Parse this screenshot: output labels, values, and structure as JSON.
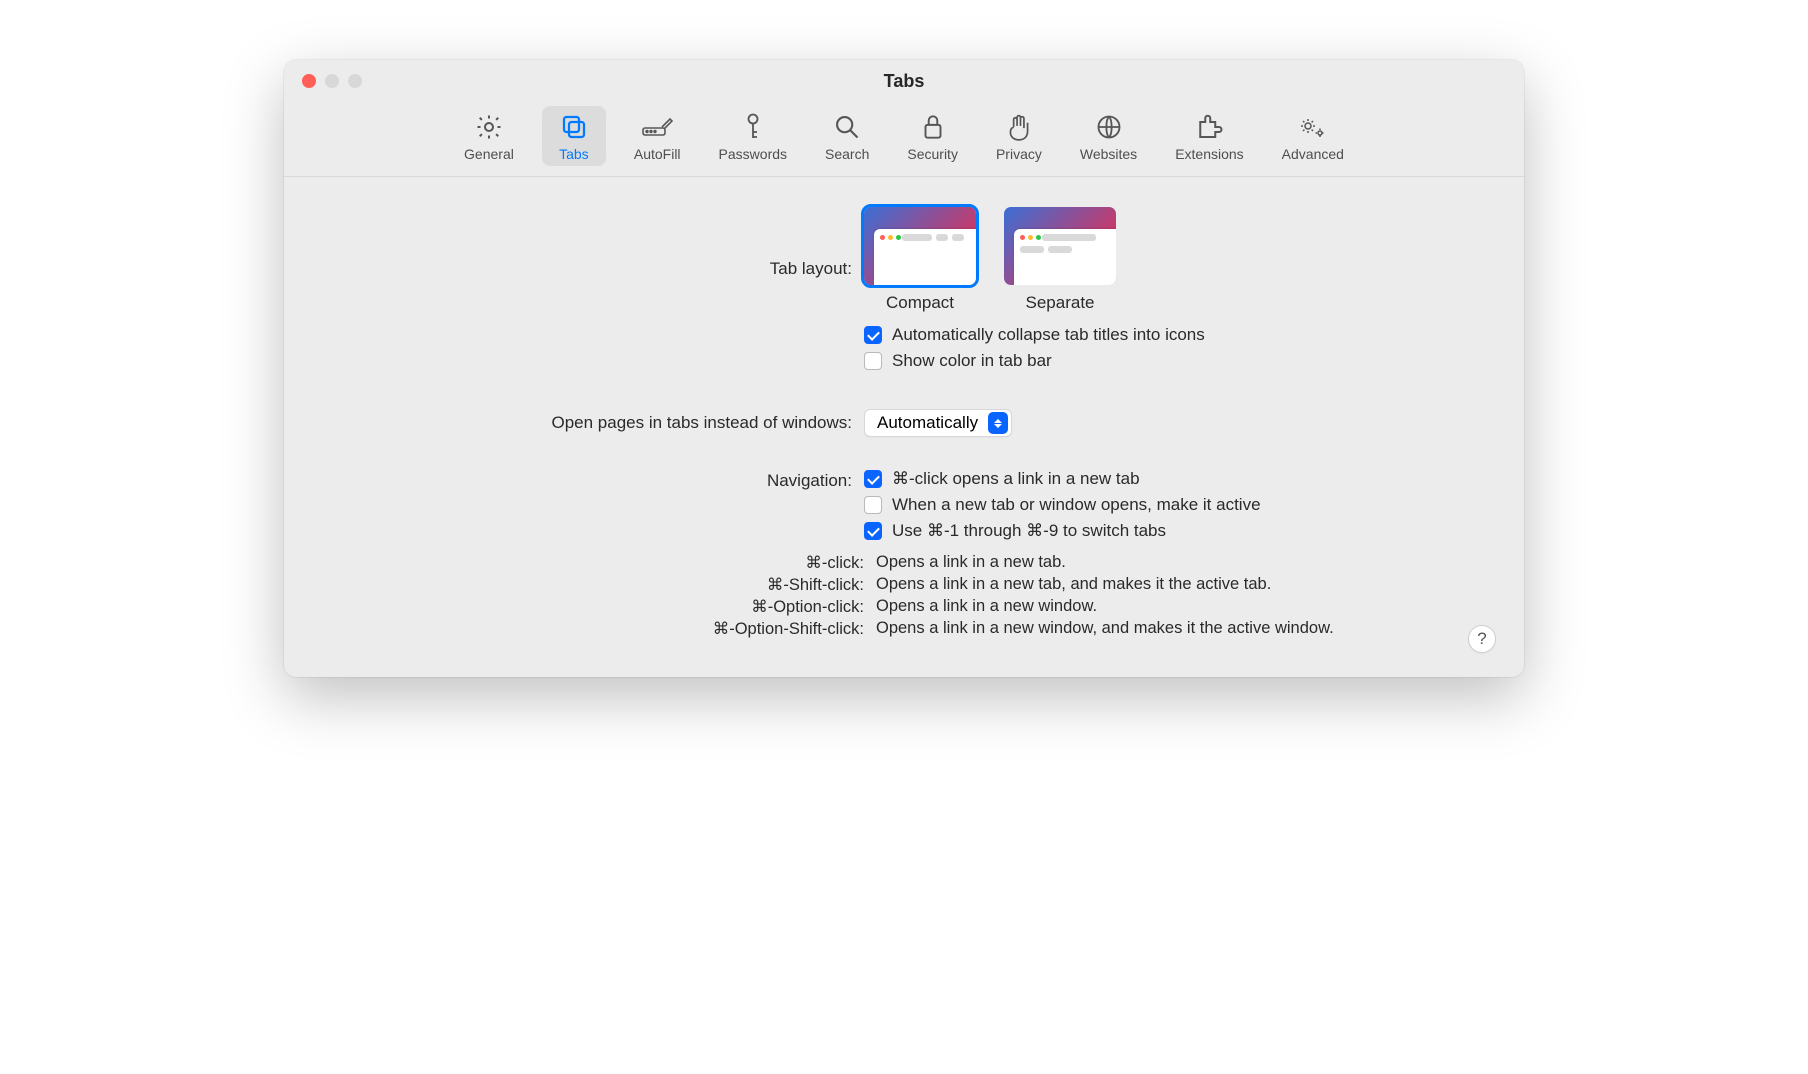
{
  "window": {
    "title": "Tabs"
  },
  "toolbar": {
    "items": [
      {
        "id": "general",
        "label": "General"
      },
      {
        "id": "tabs",
        "label": "Tabs"
      },
      {
        "id": "autofill",
        "label": "AutoFill"
      },
      {
        "id": "passwords",
        "label": "Passwords"
      },
      {
        "id": "search",
        "label": "Search"
      },
      {
        "id": "security",
        "label": "Security"
      },
      {
        "id": "privacy",
        "label": "Privacy"
      },
      {
        "id": "websites",
        "label": "Websites"
      },
      {
        "id": "extensions",
        "label": "Extensions"
      },
      {
        "id": "advanced",
        "label": "Advanced"
      }
    ],
    "selected": "tabs"
  },
  "tabLayout": {
    "label": "Tab layout:",
    "options": {
      "compact": "Compact",
      "separate": "Separate"
    },
    "selected": "compact",
    "collapseTitles": {
      "label": "Automatically collapse tab titles into icons",
      "checked": true
    },
    "showColor": {
      "label": "Show color in tab bar",
      "checked": false
    }
  },
  "openPages": {
    "label": "Open pages in tabs instead of windows:",
    "value": "Automatically"
  },
  "navigation": {
    "label": "Navigation:",
    "cmdClick": {
      "label": "⌘-click opens a link in a new tab",
      "checked": true
    },
    "makeActive": {
      "label": "When a new tab or window opens, make it active",
      "checked": false
    },
    "useCmdNum": {
      "label": "Use ⌘-1 through ⌘-9 to switch tabs",
      "checked": true
    }
  },
  "shortcuts": [
    {
      "k": "⌘-click:",
      "v": "Opens a link in a new tab."
    },
    {
      "k": "⌘-Shift-click:",
      "v": "Opens a link in a new tab, and makes it the active tab."
    },
    {
      "k": "⌘-Option-click:",
      "v": "Opens a link in a new window."
    },
    {
      "k": "⌘-Option-Shift-click:",
      "v": "Opens a link in a new window, and makes it the active window."
    }
  ],
  "help": "?"
}
